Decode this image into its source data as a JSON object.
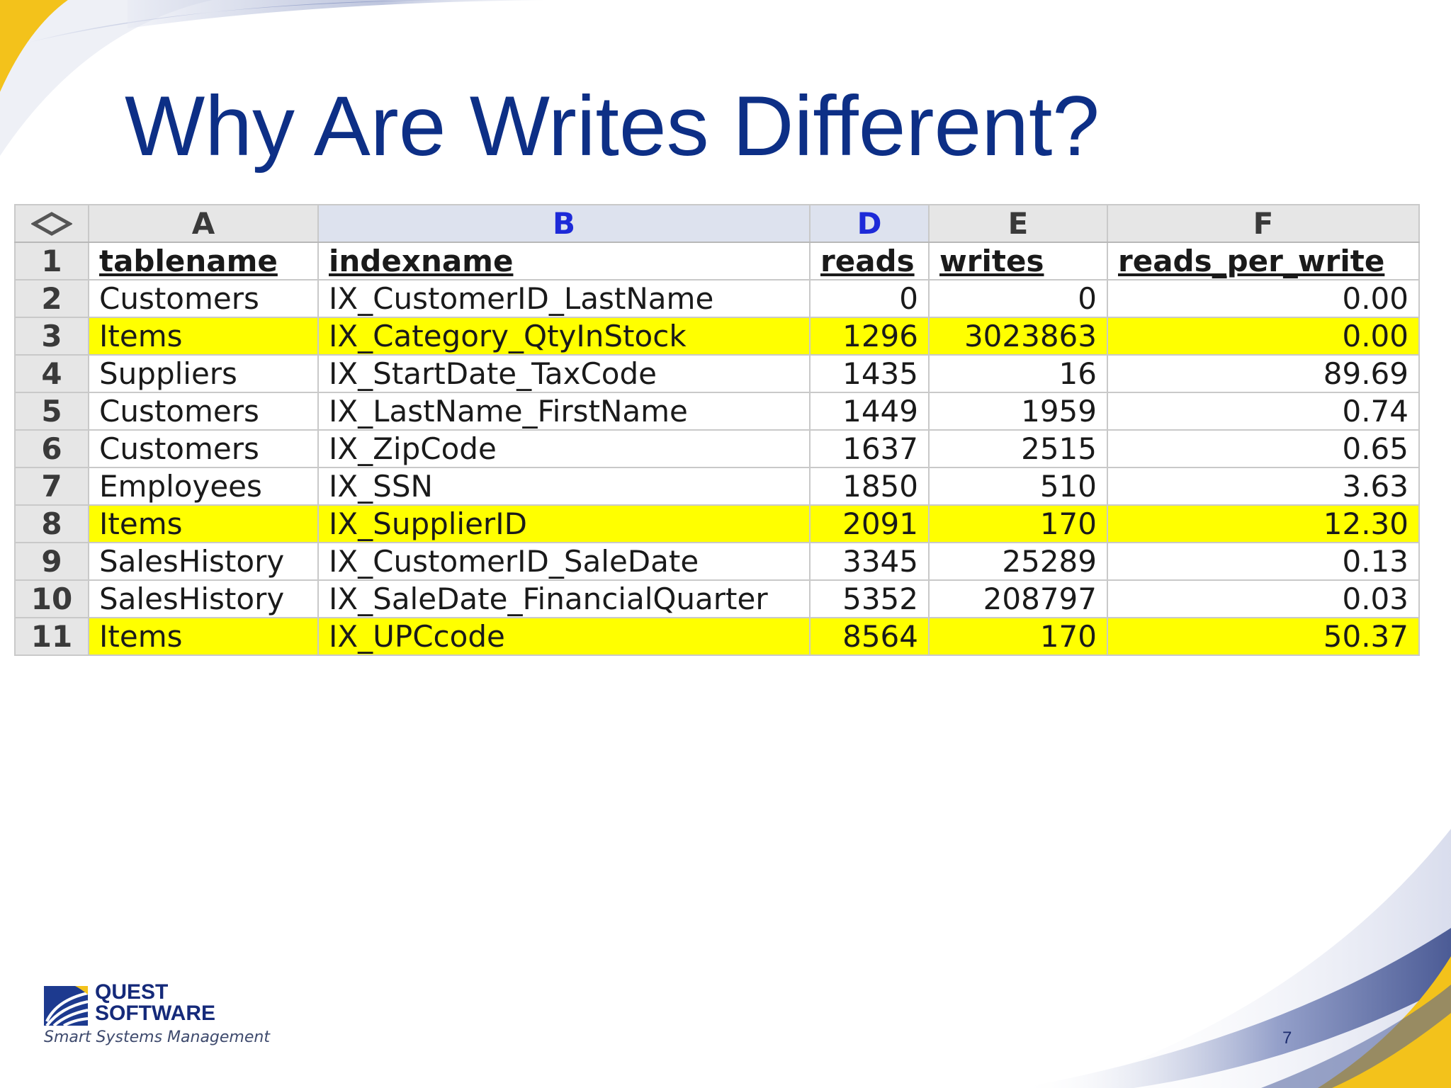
{
  "slide": {
    "title": "Why Are Writes Different?",
    "page_number": "7"
  },
  "sheet": {
    "columns": [
      "A",
      "B",
      "D",
      "E",
      "F"
    ],
    "selected_columns": [
      "B",
      "D"
    ],
    "header": {
      "row_number": "1",
      "cells": [
        "tablename",
        "indexname",
        "reads",
        "writes",
        "reads_per_write"
      ]
    },
    "rows": [
      {
        "n": "2",
        "tablename": "Customers",
        "indexname": "IX_CustomerID_LastName",
        "reads": "0",
        "writes": "0",
        "rpw": "0.00",
        "highlight": false
      },
      {
        "n": "3",
        "tablename": "Items",
        "indexname": "IX_Category_QtyInStock",
        "reads": "1296",
        "writes": "3023863",
        "rpw": "0.00",
        "highlight": true
      },
      {
        "n": "4",
        "tablename": "Suppliers",
        "indexname": "IX_StartDate_TaxCode",
        "reads": "1435",
        "writes": "16",
        "rpw": "89.69",
        "highlight": false
      },
      {
        "n": "5",
        "tablename": "Customers",
        "indexname": "IX_LastName_FirstName",
        "reads": "1449",
        "writes": "1959",
        "rpw": "0.74",
        "highlight": false
      },
      {
        "n": "6",
        "tablename": "Customers",
        "indexname": "IX_ZipCode",
        "reads": "1637",
        "writes": "2515",
        "rpw": "0.65",
        "highlight": false
      },
      {
        "n": "7",
        "tablename": "Employees",
        "indexname": "IX_SSN",
        "reads": "1850",
        "writes": "510",
        "rpw": "3.63",
        "highlight": false
      },
      {
        "n": "8",
        "tablename": "Items",
        "indexname": "IX_SupplierID",
        "reads": "2091",
        "writes": "170",
        "rpw": "12.30",
        "highlight": true
      },
      {
        "n": "9",
        "tablename": "SalesHistory",
        "indexname": "IX_CustomerID_SaleDate",
        "reads": "3345",
        "writes": "25289",
        "rpw": "0.13",
        "highlight": false
      },
      {
        "n": "10",
        "tablename": "SalesHistory",
        "indexname": "IX_SaleDate_FinancialQuarter",
        "reads": "5352",
        "writes": "208797",
        "rpw": "0.03",
        "highlight": false
      },
      {
        "n": "11",
        "tablename": "Items",
        "indexname": "IX_UPCcode",
        "reads": "8564",
        "writes": "170",
        "rpw": "50.37",
        "highlight": true
      }
    ],
    "highlight_color": "#ffff00"
  },
  "logo": {
    "line1": "QUEST",
    "line2": "SOFTWARE",
    "tagline": "Smart Systems Management",
    "icon": "quest-logo-icon"
  },
  "colors": {
    "title": "#0d2f86",
    "accent_swoosh": "#f3c21b",
    "swoosh_blue": "#4c5f9c"
  }
}
